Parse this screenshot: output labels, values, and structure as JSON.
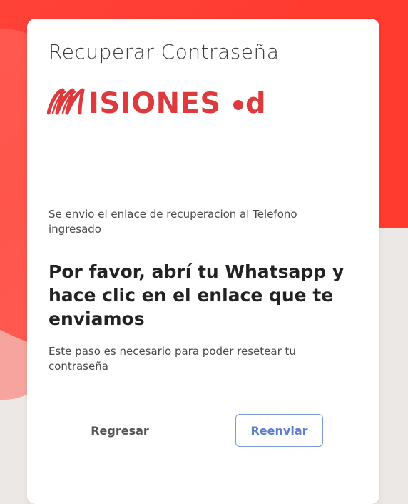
{
  "page": {
    "title": "Recuperar Contraseña"
  },
  "brand": {
    "logo_text": "MISIONESed",
    "logo_color": "#dc3a3c"
  },
  "message": {
    "notice": "Se envio el enlace de recuperacion al Telefono ingresado",
    "headline": "Por favor, abrí tu Whatsapp y hace clic en el enlace que te enviamos",
    "helper": "Este paso es necesario para poder resetear tu contraseña"
  },
  "actions": {
    "back_label": "Regresar",
    "resend_label": "Reenviar"
  },
  "colors": {
    "background_accent": "#ff3b30",
    "resend_text": "#5b7fcf",
    "resend_border": "#7a9bd6"
  }
}
